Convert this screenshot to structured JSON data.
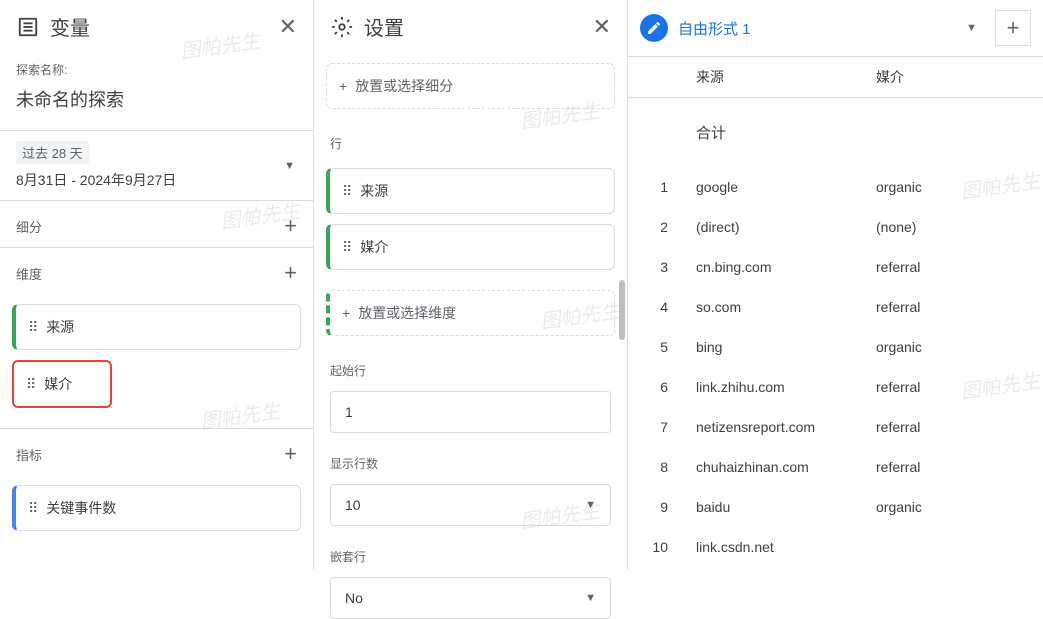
{
  "vars": {
    "title": "变量",
    "explore_label": "探索名称:",
    "explore_name": "未命名的探索",
    "date_label": "过去 28 天",
    "date_range": "8月31日 - 2024年9月27日",
    "segments_label": "细分",
    "dimensions_label": "维度",
    "dim_items": [
      "来源",
      "媒介"
    ],
    "metrics_label": "指标",
    "metric_items": [
      "关键事件数"
    ]
  },
  "settings": {
    "title": "设置",
    "drop_segment": "放置或选择细分",
    "rows_label": "行",
    "row_items": [
      "来源",
      "媒介"
    ],
    "drop_dimension": "放置或选择维度",
    "start_row_label": "起始行",
    "start_row_value": "1",
    "show_rows_label": "显示行数",
    "show_rows_value": "10",
    "nested_label": "嵌套行",
    "nested_value": "No"
  },
  "report": {
    "tab_title": "自由形式 1",
    "col_source": "来源",
    "col_medium": "媒介",
    "total_label": "合计",
    "rows": [
      {
        "idx": "1",
        "source": "google",
        "medium": "organic"
      },
      {
        "idx": "2",
        "source": "(direct)",
        "medium": "(none)"
      },
      {
        "idx": "3",
        "source": "cn.bing.com",
        "medium": "referral"
      },
      {
        "idx": "4",
        "source": "so.com",
        "medium": "referral"
      },
      {
        "idx": "5",
        "source": "bing",
        "medium": "organic"
      },
      {
        "idx": "6",
        "source": "link.zhihu.com",
        "medium": "referral"
      },
      {
        "idx": "7",
        "source": "netizensreport.com",
        "medium": "referral"
      },
      {
        "idx": "8",
        "source": "chuhaizhinan.com",
        "medium": "referral"
      },
      {
        "idx": "9",
        "source": "baidu",
        "medium": "organic"
      },
      {
        "idx": "10",
        "source": "link.csdn.net",
        "medium": ""
      }
    ]
  },
  "watermarks": [
    "图帕先生",
    "图帕先生",
    "图帕先生",
    "图帕先生",
    "图帕先生",
    "图帕先生",
    "图帕先生",
    "图帕先生"
  ]
}
